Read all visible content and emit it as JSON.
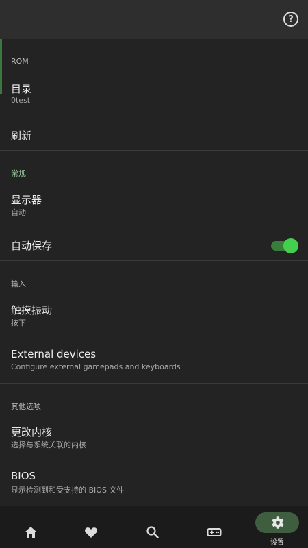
{
  "topbar": {
    "help_icon": "help-circle-icon"
  },
  "sections": {
    "rom": {
      "header": "ROM"
    },
    "general": {
      "header": "常规"
    },
    "input": {
      "header": "输入"
    },
    "other": {
      "header": "其他选项"
    }
  },
  "items": {
    "directory": {
      "title": "目录",
      "subtitle": "0test"
    },
    "refresh": {
      "title": "刷新"
    },
    "display": {
      "title": "显示器",
      "subtitle": "自动"
    },
    "autosave": {
      "title": "自动保存",
      "toggle_on": true
    },
    "haptics": {
      "title": "触摸振动",
      "subtitle": "按下"
    },
    "external": {
      "title": "External devices",
      "subtitle": "Configure external gamepads and keyboards"
    },
    "core": {
      "title": "更改内核",
      "subtitle": "选择与系统关联的内核"
    },
    "bios": {
      "title": "BIOS",
      "subtitle": "显示检测到和受支持的 BIOS 文件"
    }
  },
  "bottom_nav": {
    "items": [
      {
        "icon": "home-icon"
      },
      {
        "icon": "heart-icon"
      },
      {
        "icon": "search-icon"
      },
      {
        "icon": "gamepad-icon"
      },
      {
        "icon": "gear-icon",
        "label": "设置",
        "active": true
      }
    ]
  },
  "colors": {
    "background": "#232323",
    "topbar": "#2e2e2e",
    "accent_green": "#43d04f",
    "active_pill": "#3f5e3f"
  }
}
